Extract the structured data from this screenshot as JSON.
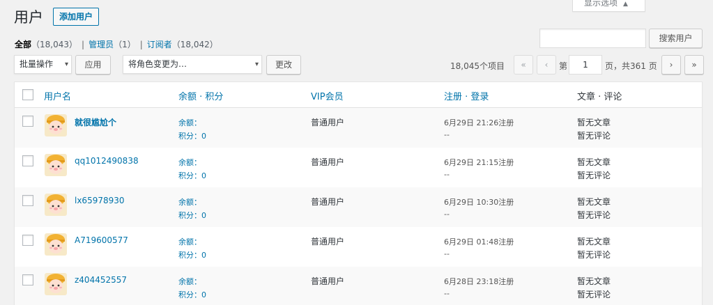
{
  "header": {
    "title": "用户",
    "add_new": "添加用户",
    "screen_options": "显示选项"
  },
  "views": [
    {
      "label": "全部",
      "count": "（18,043）",
      "current": true
    },
    {
      "label": "管理员",
      "count": "（1）",
      "current": false
    },
    {
      "label": "订阅者",
      "count": "（18,042）",
      "current": false
    }
  ],
  "search": {
    "value": "",
    "button": "搜索用户"
  },
  "bulk": {
    "selected": "批量操作",
    "apply": "应用"
  },
  "role_change": {
    "selected": "将角色变更为…",
    "button": "更改"
  },
  "pagination": {
    "items": "18,045个项目",
    "first": "«",
    "prev": "‹",
    "pre_label": "第",
    "current_page": "1",
    "post_label": "页，共361 页",
    "next": "›",
    "last": "»"
  },
  "table": {
    "columns": [
      "用户名",
      "余额 · 积分",
      "VIP会员",
      "注册 · 登录",
      "文章 · 评论"
    ],
    "rows": [
      {
        "username": "就很尴尬个",
        "bold": true,
        "balance": "余额：",
        "points": "积分：0",
        "vip": "普通用户",
        "registered": "6月29日 21:26注册",
        "login": "--",
        "posts": "暂无文章",
        "comments": "暂无评论"
      },
      {
        "username": "qq1012490838",
        "bold": false,
        "balance": "余额：",
        "points": "积分：0",
        "vip": "普通用户",
        "registered": "6月29日 21:15注册",
        "login": "--",
        "posts": "暂无文章",
        "comments": "暂无评论"
      },
      {
        "username": "lx65978930",
        "bold": false,
        "balance": "余额：",
        "points": "积分：0",
        "vip": "普通用户",
        "registered": "6月29日 10:30注册",
        "login": "--",
        "posts": "暂无文章",
        "comments": "暂无评论"
      },
      {
        "username": "A719600577",
        "bold": false,
        "balance": "余额：",
        "points": "积分：0",
        "vip": "普通用户",
        "registered": "6月29日 01:48注册",
        "login": "--",
        "posts": "暂无文章",
        "comments": "暂无评论"
      },
      {
        "username": "z404452557",
        "bold": false,
        "balance": "余额：",
        "points": "积分：0",
        "vip": "普通用户",
        "registered": "6月28日 23:18注册",
        "login": "--",
        "posts": "暂无文章",
        "comments": "暂无评论"
      }
    ]
  }
}
